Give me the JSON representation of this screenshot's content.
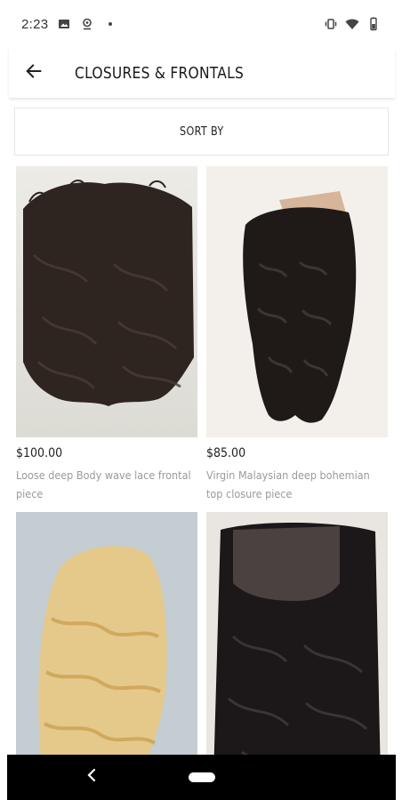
{
  "status_bar": {
    "time": "2:23",
    "left_icons": [
      "image-icon",
      "location-icon",
      "dot-icon"
    ],
    "right_icons": [
      "vibrate-icon",
      "wifi-icon",
      "battery-icon"
    ]
  },
  "header": {
    "title": "CLOSURES & FRONTALS",
    "back_icon": "arrow-left-icon"
  },
  "sort": {
    "label": "SORT BY"
  },
  "products": [
    {
      "price": "$100.00",
      "name": "Loose deep Body wave lace frontal piece"
    },
    {
      "price": "$85.00",
      "name": "Virgin Malaysian deep bohemian top closure piece"
    },
    {
      "price": "",
      "name": ""
    },
    {
      "price": "",
      "name": ""
    }
  ],
  "nav_bar": {
    "back_icon": "chevron-left-icon",
    "home_icon": "home-pill-icon"
  },
  "colors": {
    "background": "#ffffff",
    "text_primary": "#222222",
    "text_secondary": "#9a9a9a",
    "nav_bar": "#000000"
  }
}
